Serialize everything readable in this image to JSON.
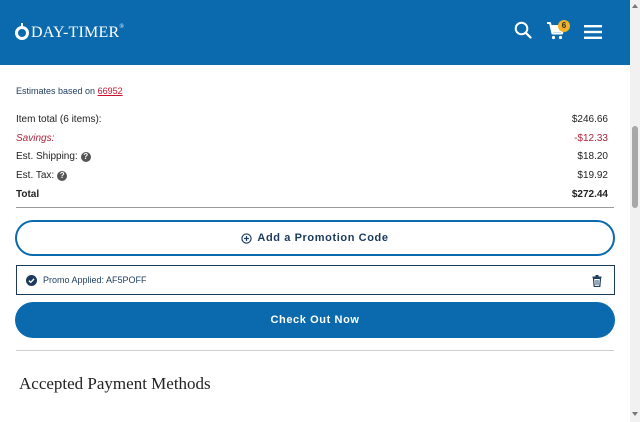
{
  "header": {
    "brand": "DAY-TIMER",
    "brand_mark": "®",
    "cart_count": "6",
    "icons": [
      "search-icon",
      "cart-icon",
      "menu-icon"
    ],
    "background": "#0a6aad"
  },
  "summary": {
    "estimates_prefix": "Estimates based on",
    "zip": "66952",
    "rows": {
      "item_total": {
        "label": "Item total (6 items):",
        "value": "$246.66"
      },
      "savings": {
        "label": "Savings:",
        "value": "-$12.33"
      },
      "shipping": {
        "label": "Est. Shipping:",
        "value": "$18.20"
      },
      "tax": {
        "label": "Est. Tax:",
        "value": "$19.92"
      },
      "total": {
        "label": "Total",
        "value": "$272.44"
      }
    },
    "help_glyph": "?"
  },
  "actions": {
    "promo_label": "Add a Promotion Code",
    "promo_applied": "Promo Applied: AF5POFF",
    "checkout_label": "Check Out Now"
  },
  "payment": {
    "title": "Accepted Payment Methods"
  },
  "colors": {
    "accent": "#0a6aad",
    "savings": "#b0233b",
    "badge": "#f0b323"
  }
}
